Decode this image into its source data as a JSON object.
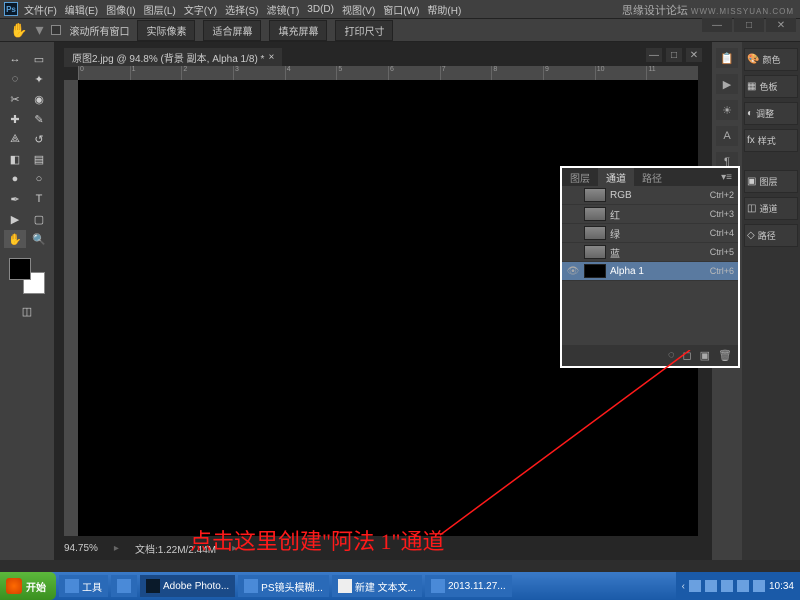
{
  "watermark": {
    "title": "思缘设计论坛",
    "sub": "WWW.MISSYUAN.COM"
  },
  "menu": [
    "文件(F)",
    "编辑(E)",
    "图像(I)",
    "图层(L)",
    "文字(Y)",
    "选择(S)",
    "滤镜(T)",
    "3D(D)",
    "视图(V)",
    "窗口(W)",
    "帮助(H)"
  ],
  "options": {
    "scrollAll": "滚动所有窗口",
    "actualPixels": "实际像素",
    "fitScreen": "适合屏幕",
    "fillScreen": "填充屏幕",
    "printSize": "打印尺寸"
  },
  "document": {
    "tab": "原图2.jpg @ 94.8% (背景 副本, Alpha 1/8) *"
  },
  "status": {
    "zoom": "94.75%",
    "docsize": "文档:1.22M/2.44M"
  },
  "ruler": [
    "0",
    "1",
    "2",
    "3",
    "4",
    "5",
    "6",
    "7",
    "8",
    "9",
    "10",
    "11"
  ],
  "panels": {
    "color": "颜色",
    "swatches": "色板",
    "adjust": "调整",
    "styles": "样式",
    "layers": "图层",
    "channels": "通道",
    "paths": "路径"
  },
  "channelPanel": {
    "tabs": {
      "layers": "图层",
      "channels": "通道",
      "paths": "路径"
    },
    "rows": [
      {
        "name": "RGB",
        "key": "Ctrl+2",
        "eye": false,
        "thumb": "img"
      },
      {
        "name": "红",
        "key": "Ctrl+3",
        "eye": false,
        "thumb": "img"
      },
      {
        "name": "绿",
        "key": "Ctrl+4",
        "eye": false,
        "thumb": "img"
      },
      {
        "name": "蓝",
        "key": "Ctrl+5",
        "eye": false,
        "thumb": "img"
      },
      {
        "name": "Alpha 1",
        "key": "Ctrl+6",
        "eye": true,
        "thumb": "black",
        "selected": true
      }
    ]
  },
  "annotation": "点击这里创建\"阿法 1\"通道",
  "taskbar": {
    "start": "开始",
    "items": [
      {
        "label": "工具",
        "icon": "folder"
      },
      {
        "label": "",
        "icon": "blank"
      },
      {
        "label": "Adobe Photo...",
        "icon": "ps",
        "active": true
      },
      {
        "label": "PS镜头模糊...",
        "icon": "folder"
      },
      {
        "label": "新建 文本文...",
        "icon": "txt"
      },
      {
        "label": "2013.11.27...",
        "icon": "folder"
      }
    ],
    "time": "10:34"
  }
}
